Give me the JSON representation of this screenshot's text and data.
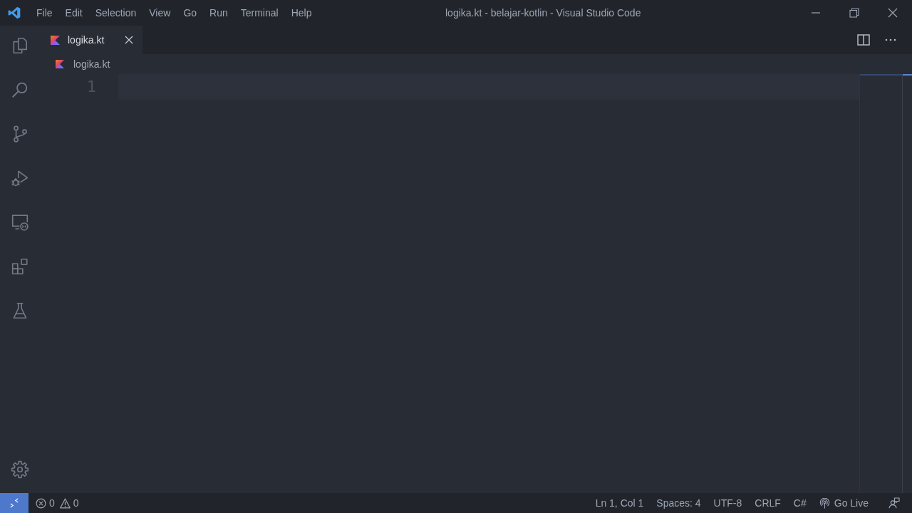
{
  "title_bar": {
    "menu": [
      "File",
      "Edit",
      "Selection",
      "View",
      "Go",
      "Run",
      "Terminal",
      "Help"
    ],
    "title": "logika.kt - belajar-kotlin - Visual Studio Code"
  },
  "tabs": [
    {
      "label": "logika.kt",
      "selected": true
    }
  ],
  "breadcrumb": [
    "logika.kt"
  ],
  "editor": {
    "line_numbers": [
      "1"
    ]
  },
  "status_bar": {
    "errors": "0",
    "warnings": "0",
    "cursor_position": "Ln 1, Col 1",
    "indentation": "Spaces: 4",
    "encoding": "UTF-8",
    "line_ending": "CRLF",
    "language": "C#",
    "go_live": "Go Live"
  }
}
